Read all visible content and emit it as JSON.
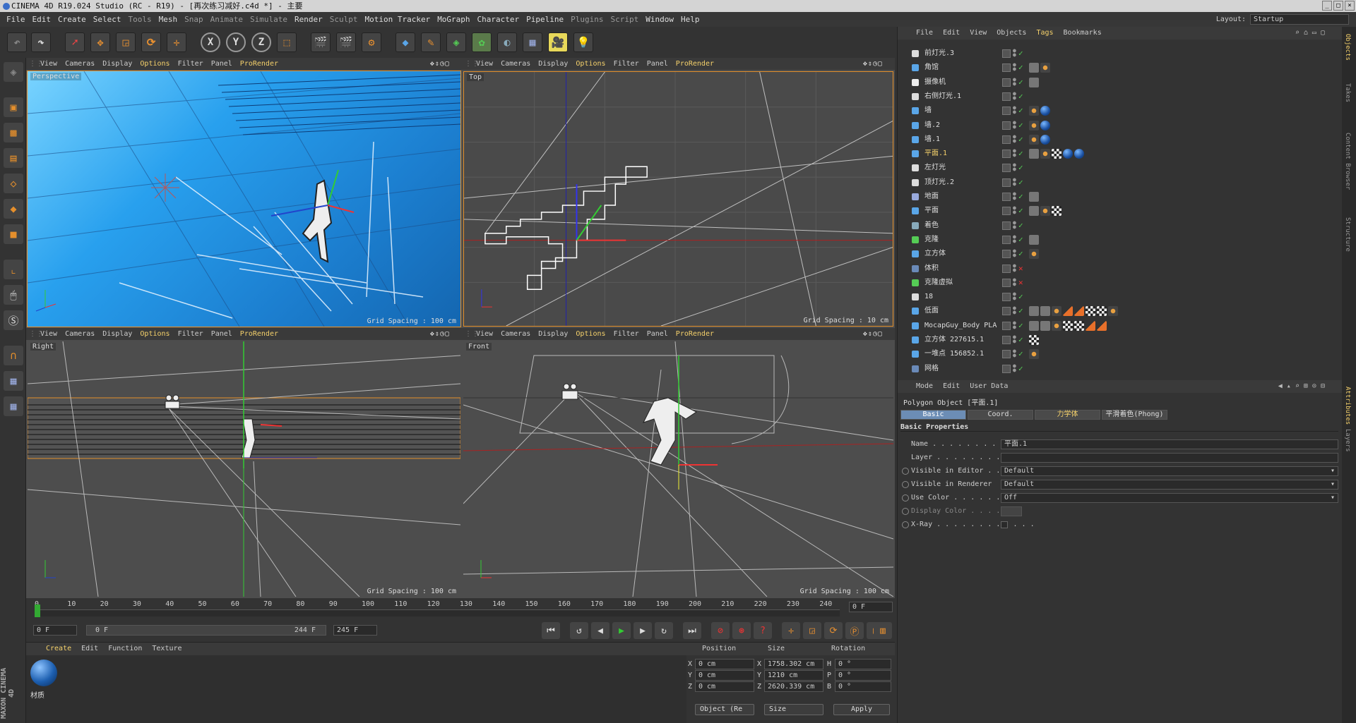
{
  "window": {
    "title": "CINEMA 4D R19.024 Studio (RC - R19) - [再次练习减好.c4d *] - 主要"
  },
  "menu": [
    "File",
    "Edit",
    "Create",
    "Select",
    "Tools",
    "Mesh",
    "Snap",
    "Animate",
    "Simulate",
    "Render",
    "Sculpt",
    "Motion Tracker",
    "MoGraph",
    "Character",
    "Pipeline",
    "Plugins",
    "Script",
    "Window",
    "Help"
  ],
  "layout": {
    "label": "Layout:",
    "value": "Startup"
  },
  "viewport_menu": [
    "View",
    "Cameras",
    "Display",
    "Options",
    "Filter",
    "Panel",
    "ProRender"
  ],
  "viewports": [
    {
      "name": "Perspective",
      "grid": "Grid Spacing : 100 cm"
    },
    {
      "name": "Top",
      "grid": "Grid Spacing : 10 cm"
    },
    {
      "name": "Right",
      "grid": "Grid Spacing : 100 cm"
    },
    {
      "name": "Front",
      "grid": "Grid Spacing : 100 cm"
    }
  ],
  "timeline": {
    "ticks": [
      "0",
      "10",
      "20",
      "30",
      "40",
      "50",
      "60",
      "70",
      "80",
      "90",
      "100",
      "110",
      "120",
      "130",
      "140",
      "150",
      "160",
      "170",
      "180",
      "190",
      "200",
      "210",
      "220",
      "230",
      "240"
    ],
    "current_frame": "0 F",
    "start": "0 F",
    "range_start": "0 F",
    "range_end": "244 F",
    "end": "245 F"
  },
  "material_panel": {
    "menu": [
      "Create",
      "Edit",
      "Function",
      "Texture"
    ],
    "material_name": "材质"
  },
  "coords": {
    "headers": {
      "position": "Position",
      "size": "Size",
      "rotation": "Rotation"
    },
    "rows": [
      {
        "axis": "X",
        "pos": "0 cm",
        "saxis": "X",
        "size": "1758.302 cm",
        "raxis": "H",
        "rot": "0 °"
      },
      {
        "axis": "Y",
        "pos": "0 cm",
        "saxis": "Y",
        "size": "1210 cm",
        "raxis": "P",
        "rot": "0 °"
      },
      {
        "axis": "Z",
        "pos": "0 cm",
        "saxis": "Z",
        "size": "2620.339 cm",
        "raxis": "B",
        "rot": "0 °"
      }
    ],
    "mode": "Object (Re",
    "size_mode": "Size",
    "apply": "Apply"
  },
  "object_manager": {
    "menu": [
      "File",
      "Edit",
      "View",
      "Objects",
      "Tags",
      "Bookmarks"
    ],
    "objects": [
      {
        "name": "前灯光.3",
        "icon": "light",
        "tags": []
      },
      {
        "name": "角馆",
        "icon": "poly",
        "tags": [
          "w",
          "o"
        ]
      },
      {
        "name": "摄像机",
        "icon": "camera",
        "tags": [
          "w"
        ]
      },
      {
        "name": "右侧灯光.1",
        "icon": "light",
        "tags": []
      },
      {
        "name": "墙",
        "icon": "plane",
        "tags": [
          "o",
          "b"
        ]
      },
      {
        "name": "墙.2",
        "icon": "plane",
        "tags": [
          "o",
          "b"
        ]
      },
      {
        "name": "墙.1",
        "icon": "plane",
        "tags": [
          "o",
          "b"
        ]
      },
      {
        "name": "平面.1",
        "icon": "poly",
        "tags": [
          "w",
          "o",
          "c",
          "b",
          "b"
        ],
        "selected": true
      },
      {
        "name": "左灯光",
        "icon": "light",
        "tags": []
      },
      {
        "name": "顶灯光.2",
        "icon": "light",
        "tags": []
      },
      {
        "name": "地面",
        "icon": "floor",
        "tags": [
          "w"
        ]
      },
      {
        "name": "平面",
        "icon": "poly",
        "tags": [
          "w",
          "o",
          "c"
        ]
      },
      {
        "name": "着色",
        "icon": "shader",
        "tags": []
      },
      {
        "name": "克隆",
        "icon": "cloner",
        "tags": [
          "w"
        ]
      },
      {
        "name": "立方体",
        "icon": "cube",
        "tags": [
          "o"
        ]
      },
      {
        "name": "体积",
        "icon": "volume",
        "tags": []
      },
      {
        "name": "克隆虚拟",
        "icon": "cloner",
        "tags": []
      },
      {
        "name": "18",
        "icon": "null",
        "tags": []
      },
      {
        "name": "低面",
        "icon": "poly",
        "tags": [
          "w",
          "w",
          "o",
          "t",
          "t",
          "c",
          "c",
          "o"
        ]
      },
      {
        "name": "MocapGuy_Body PLA",
        "icon": "poly",
        "tags": [
          "w",
          "w",
          "o",
          "c",
          "c",
          "t",
          "t"
        ]
      },
      {
        "name": "立方体 227615.1",
        "icon": "poly",
        "tags": [
          "c"
        ]
      },
      {
        "name": "一堆点 156852.1",
        "icon": "poly",
        "tags": [
          "o"
        ]
      },
      {
        "name": "网格",
        "icon": "mesh",
        "tags": []
      }
    ]
  },
  "attributes": {
    "menu": [
      "Mode",
      "Edit",
      "User Data"
    ],
    "title": "Polygon Object [平面.1]",
    "tabs": [
      "Basic",
      "Coord.",
      "力学体",
      "平滑着色(Phong)"
    ],
    "section": "Basic Properties",
    "rows": [
      {
        "label": "Name . . . . . . . . . . . . . .",
        "value": "平面.1"
      },
      {
        "label": "Layer . . . . . . . . . . . . .",
        "value": ""
      },
      {
        "label": "Visible in Editor . .",
        "value": "Default"
      },
      {
        "label": "Visible in Renderer",
        "value": "Default"
      },
      {
        "label": "Use Color . . . . . . . . .",
        "value": "Off"
      },
      {
        "label": "Display Color . . . .",
        "value": ""
      },
      {
        "label": "X-Ray . . . . . . . . . . . .",
        "value": ""
      }
    ]
  },
  "side_tabs": [
    "Objects",
    "Takes",
    "Content Browser",
    "Structure",
    "Attributes",
    "Layers"
  ],
  "maxon": "MAXON CINEMA 4D"
}
